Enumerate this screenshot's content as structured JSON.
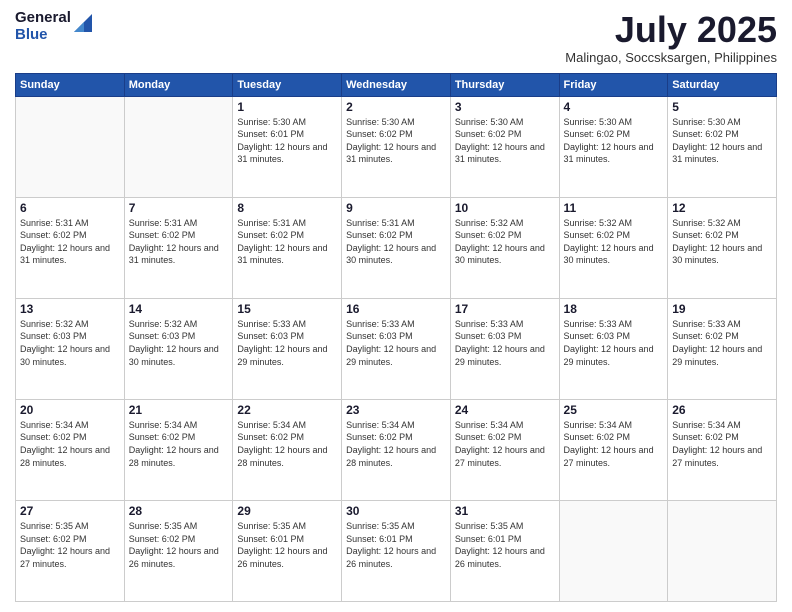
{
  "header": {
    "logo_general": "General",
    "logo_blue": "Blue",
    "month_title": "July 2025",
    "location": "Malingao, Soccsksargen, Philippines"
  },
  "days_of_week": [
    "Sunday",
    "Monday",
    "Tuesday",
    "Wednesday",
    "Thursday",
    "Friday",
    "Saturday"
  ],
  "weeks": [
    [
      {
        "day": "",
        "info": ""
      },
      {
        "day": "",
        "info": ""
      },
      {
        "day": "1",
        "info": "Sunrise: 5:30 AM\nSunset: 6:01 PM\nDaylight: 12 hours and 31 minutes."
      },
      {
        "day": "2",
        "info": "Sunrise: 5:30 AM\nSunset: 6:02 PM\nDaylight: 12 hours and 31 minutes."
      },
      {
        "day": "3",
        "info": "Sunrise: 5:30 AM\nSunset: 6:02 PM\nDaylight: 12 hours and 31 minutes."
      },
      {
        "day": "4",
        "info": "Sunrise: 5:30 AM\nSunset: 6:02 PM\nDaylight: 12 hours and 31 minutes."
      },
      {
        "day": "5",
        "info": "Sunrise: 5:30 AM\nSunset: 6:02 PM\nDaylight: 12 hours and 31 minutes."
      }
    ],
    [
      {
        "day": "6",
        "info": "Sunrise: 5:31 AM\nSunset: 6:02 PM\nDaylight: 12 hours and 31 minutes."
      },
      {
        "day": "7",
        "info": "Sunrise: 5:31 AM\nSunset: 6:02 PM\nDaylight: 12 hours and 31 minutes."
      },
      {
        "day": "8",
        "info": "Sunrise: 5:31 AM\nSunset: 6:02 PM\nDaylight: 12 hours and 31 minutes."
      },
      {
        "day": "9",
        "info": "Sunrise: 5:31 AM\nSunset: 6:02 PM\nDaylight: 12 hours and 30 minutes."
      },
      {
        "day": "10",
        "info": "Sunrise: 5:32 AM\nSunset: 6:02 PM\nDaylight: 12 hours and 30 minutes."
      },
      {
        "day": "11",
        "info": "Sunrise: 5:32 AM\nSunset: 6:02 PM\nDaylight: 12 hours and 30 minutes."
      },
      {
        "day": "12",
        "info": "Sunrise: 5:32 AM\nSunset: 6:02 PM\nDaylight: 12 hours and 30 minutes."
      }
    ],
    [
      {
        "day": "13",
        "info": "Sunrise: 5:32 AM\nSunset: 6:03 PM\nDaylight: 12 hours and 30 minutes."
      },
      {
        "day": "14",
        "info": "Sunrise: 5:32 AM\nSunset: 6:03 PM\nDaylight: 12 hours and 30 minutes."
      },
      {
        "day": "15",
        "info": "Sunrise: 5:33 AM\nSunset: 6:03 PM\nDaylight: 12 hours and 29 minutes."
      },
      {
        "day": "16",
        "info": "Sunrise: 5:33 AM\nSunset: 6:03 PM\nDaylight: 12 hours and 29 minutes."
      },
      {
        "day": "17",
        "info": "Sunrise: 5:33 AM\nSunset: 6:03 PM\nDaylight: 12 hours and 29 minutes."
      },
      {
        "day": "18",
        "info": "Sunrise: 5:33 AM\nSunset: 6:03 PM\nDaylight: 12 hours and 29 minutes."
      },
      {
        "day": "19",
        "info": "Sunrise: 5:33 AM\nSunset: 6:02 PM\nDaylight: 12 hours and 29 minutes."
      }
    ],
    [
      {
        "day": "20",
        "info": "Sunrise: 5:34 AM\nSunset: 6:02 PM\nDaylight: 12 hours and 28 minutes."
      },
      {
        "day": "21",
        "info": "Sunrise: 5:34 AM\nSunset: 6:02 PM\nDaylight: 12 hours and 28 minutes."
      },
      {
        "day": "22",
        "info": "Sunrise: 5:34 AM\nSunset: 6:02 PM\nDaylight: 12 hours and 28 minutes."
      },
      {
        "day": "23",
        "info": "Sunrise: 5:34 AM\nSunset: 6:02 PM\nDaylight: 12 hours and 28 minutes."
      },
      {
        "day": "24",
        "info": "Sunrise: 5:34 AM\nSunset: 6:02 PM\nDaylight: 12 hours and 27 minutes."
      },
      {
        "day": "25",
        "info": "Sunrise: 5:34 AM\nSunset: 6:02 PM\nDaylight: 12 hours and 27 minutes."
      },
      {
        "day": "26",
        "info": "Sunrise: 5:34 AM\nSunset: 6:02 PM\nDaylight: 12 hours and 27 minutes."
      }
    ],
    [
      {
        "day": "27",
        "info": "Sunrise: 5:35 AM\nSunset: 6:02 PM\nDaylight: 12 hours and 27 minutes."
      },
      {
        "day": "28",
        "info": "Sunrise: 5:35 AM\nSunset: 6:02 PM\nDaylight: 12 hours and 26 minutes."
      },
      {
        "day": "29",
        "info": "Sunrise: 5:35 AM\nSunset: 6:01 PM\nDaylight: 12 hours and 26 minutes."
      },
      {
        "day": "30",
        "info": "Sunrise: 5:35 AM\nSunset: 6:01 PM\nDaylight: 12 hours and 26 minutes."
      },
      {
        "day": "31",
        "info": "Sunrise: 5:35 AM\nSunset: 6:01 PM\nDaylight: 12 hours and 26 minutes."
      },
      {
        "day": "",
        "info": ""
      },
      {
        "day": "",
        "info": ""
      }
    ]
  ]
}
